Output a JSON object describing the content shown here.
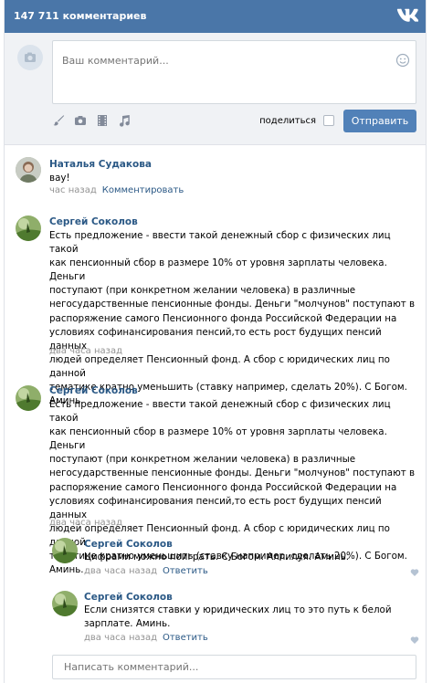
{
  "header": {
    "count_label": "147 711 комментариев",
    "logo_icon": "vk-logo-icon"
  },
  "composer": {
    "placeholder": "Ваш комментарий...",
    "share_label": "поделиться",
    "send_label": "Отправить",
    "tool_icons": [
      "brush-icon",
      "camera-icon",
      "film-icon",
      "music-icon"
    ]
  },
  "comments": [
    {
      "author": "Наталья Судакова",
      "text": "вау!",
      "time": "час назад",
      "reply_link": "Комментировать"
    },
    {
      "author": "Сергей Соколов",
      "lines": [
        "Есть предложение - ввести такой денежный сбор с физических лиц такой",
        "как пенсионный сбор в размере 10% от уровня зарплаты человека. Деньги",
        "поступают (при конкретном желании человека) в различные",
        "негосударственные пенсионные фонды. Деньги \"молчунов\" поступают в",
        "распоряжение самого Пенсионного фонда Российской Федерации на",
        "условиях софинансирования пенсий,то есть рост будущих пенсий данных",
        "людей определяет Пенсионный фонд. А сбор с юридических лиц по данной",
        "тематике кратно уменьшить (ставку например, сделать 20%). С Богом.",
        "Аминь."
      ],
      "time": "два часа назад"
    },
    {
      "author": "Сергей Соколов",
      "lines": [
        "Есть предложение - ввести такой денежный сбор с физических лиц такой",
        "как пенсионный сбор в размере 10% от уровня зарплаты человека. Деньги",
        "поступают (при конкретном желании человека) в различные",
        "негосударственные пенсионные фонды. Деньги \"молчунов\" поступают в",
        "распоряжение самого Пенсионного фонда Российской Федерации на",
        "условиях софинансирования пенсий,то есть рост будущих пенсий данных",
        "людей определяет Пенсионный фонд. А сбор с юридических лиц по данной",
        "тематике кратно уменьшить (ставку например, сделать 20%). С Богом.",
        "Аминь."
      ],
      "time": "два часа назад"
    }
  ],
  "replies": [
    {
      "author": "Сергей Соколов",
      "lines": [
        "Цифрами можно поиграть. С Богом. Аллилуя. Аминь."
      ],
      "time": "два часа назад",
      "reply_link": "Ответить"
    },
    {
      "author": "Сергей Соколов",
      "lines": [
        "Если снизятся ставки у юридических лиц то это путь к белой",
        "зарплате. Аминь."
      ],
      "time": "два часа назад",
      "reply_link": "Ответить"
    }
  ],
  "bottom_input": {
    "placeholder": "Написать комментарий..."
  },
  "colors": {
    "header": "#4a76a8",
    "link": "#2a5885",
    "button": "#5181b8"
  }
}
